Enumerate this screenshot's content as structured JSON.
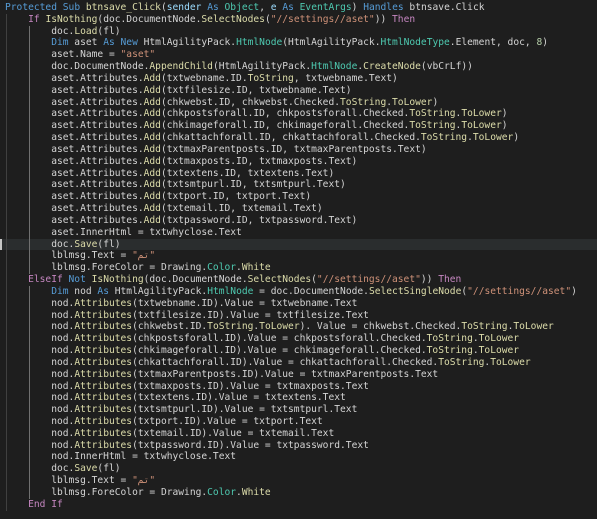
{
  "editor": {
    "colors": {
      "background": "#1e1e1e",
      "text": "#d4d4d4",
      "keyword": "#569cd6",
      "control": "#c586c0",
      "function": "#dcdcaa",
      "type": "#4ec9b0",
      "string": "#ce9178",
      "number": "#b5cea8",
      "variable": "#9cdcfe"
    },
    "lines": [
      {
        "indent": 0,
        "tokens": [
          [
            "kw",
            "Protected"
          ],
          [
            "txt",
            " "
          ],
          [
            "kw",
            "Sub"
          ],
          [
            "txt",
            " "
          ],
          [
            "fn",
            "btnsave_Click"
          ],
          [
            "txt",
            "("
          ],
          [
            "var",
            "sender"
          ],
          [
            "txt",
            " "
          ],
          [
            "kw",
            "As"
          ],
          [
            "txt",
            " "
          ],
          [
            "type",
            "Object"
          ],
          [
            "txt",
            ", "
          ],
          [
            "var",
            "e"
          ],
          [
            "txt",
            " "
          ],
          [
            "kw",
            "As"
          ],
          [
            "txt",
            " "
          ],
          [
            "type",
            "EventArgs"
          ],
          [
            "txt",
            ") "
          ],
          [
            "kw",
            "Handles"
          ],
          [
            "txt",
            " btnsave.Click"
          ]
        ]
      },
      {
        "indent": 1,
        "tokens": [
          [
            "ctl",
            "If"
          ],
          [
            "txt",
            " "
          ],
          [
            "fn",
            "IsNothing"
          ],
          [
            "txt",
            "(doc.DocumentNode."
          ],
          [
            "fn",
            "SelectNodes"
          ],
          [
            "txt",
            "("
          ],
          [
            "str",
            "\"//settings//aset\""
          ],
          [
            "txt",
            ")) "
          ],
          [
            "ctl",
            "Then"
          ]
        ]
      },
      {
        "indent": 2,
        "tokens": [
          [
            "txt",
            "doc."
          ],
          [
            "fn",
            "Load"
          ],
          [
            "txt",
            "(fl)"
          ]
        ]
      },
      {
        "indent": 2,
        "tokens": [
          [
            "kw",
            "Dim"
          ],
          [
            "txt",
            " aset "
          ],
          [
            "kw",
            "As"
          ],
          [
            "txt",
            " "
          ],
          [
            "kw",
            "New"
          ],
          [
            "txt",
            " HtmlAgilityPack."
          ],
          [
            "type",
            "HtmlNode"
          ],
          [
            "txt",
            "(HtmlAgilityPack."
          ],
          [
            "type",
            "HtmlNodeType"
          ],
          [
            "txt",
            ".Element, doc, "
          ],
          [
            "num",
            "8"
          ],
          [
            "txt",
            ")"
          ]
        ]
      },
      {
        "indent": 2,
        "tokens": [
          [
            "txt",
            "aset.Name = "
          ],
          [
            "str",
            "\"aset\""
          ]
        ]
      },
      {
        "indent": 2,
        "tokens": [
          [
            "txt",
            "doc.DocumentNode."
          ],
          [
            "fn",
            "AppendChild"
          ],
          [
            "txt",
            "(HtmlAgilityPack."
          ],
          [
            "type",
            "HtmlNode"
          ],
          [
            "txt",
            "."
          ],
          [
            "fn",
            "CreateNode"
          ],
          [
            "txt",
            "(vbCrLf))"
          ]
        ]
      },
      {
        "indent": 2,
        "tokens": [
          [
            "txt",
            "aset.Attributes."
          ],
          [
            "fn",
            "Add"
          ],
          [
            "txt",
            "(txtwebname.ID."
          ],
          [
            "fn",
            "ToString"
          ],
          [
            "txt",
            ", txtwebname.Text)"
          ]
        ]
      },
      {
        "indent": 2,
        "tokens": [
          [
            "txt",
            "aset.Attributes."
          ],
          [
            "fn",
            "Add"
          ],
          [
            "txt",
            "(txtfilesize.ID, txtwebname.Text)"
          ]
        ]
      },
      {
        "indent": 2,
        "tokens": [
          [
            "txt",
            "aset.Attributes."
          ],
          [
            "fn",
            "Add"
          ],
          [
            "txt",
            "(chkwebst.ID, chkwebst.Checked."
          ],
          [
            "fn",
            "ToString"
          ],
          [
            "txt",
            "."
          ],
          [
            "fn",
            "ToLower"
          ],
          [
            "txt",
            ")"
          ]
        ]
      },
      {
        "indent": 2,
        "tokens": [
          [
            "txt",
            "aset.Attributes."
          ],
          [
            "fn",
            "Add"
          ],
          [
            "txt",
            "(chkpostsforall.ID, chkpostsforall.Checked."
          ],
          [
            "fn",
            "ToString"
          ],
          [
            "txt",
            "."
          ],
          [
            "fn",
            "ToLower"
          ],
          [
            "txt",
            ")"
          ]
        ]
      },
      {
        "indent": 2,
        "tokens": [
          [
            "txt",
            "aset.Attributes."
          ],
          [
            "fn",
            "Add"
          ],
          [
            "txt",
            "(chkimageforall.ID, chkimageforall.Checked."
          ],
          [
            "fn",
            "ToString"
          ],
          [
            "txt",
            "."
          ],
          [
            "fn",
            "ToLower"
          ],
          [
            "txt",
            ")"
          ]
        ]
      },
      {
        "indent": 2,
        "tokens": [
          [
            "txt",
            "aset.Attributes."
          ],
          [
            "fn",
            "Add"
          ],
          [
            "txt",
            "(chkattachforall.ID, chkattachforall.Checked."
          ],
          [
            "fn",
            "ToString"
          ],
          [
            "txt",
            "."
          ],
          [
            "fn",
            "ToLower"
          ],
          [
            "txt",
            ")"
          ]
        ]
      },
      {
        "indent": 2,
        "tokens": [
          [
            "txt",
            "aset.Attributes."
          ],
          [
            "fn",
            "Add"
          ],
          [
            "txt",
            "(txtmaxParentposts.ID, txtmaxParentposts.Text)"
          ]
        ]
      },
      {
        "indent": 2,
        "tokens": [
          [
            "txt",
            "aset.Attributes."
          ],
          [
            "fn",
            "Add"
          ],
          [
            "txt",
            "(txtmaxposts.ID, txtmaxposts.Text)"
          ]
        ]
      },
      {
        "indent": 2,
        "tokens": [
          [
            "txt",
            "aset.Attributes."
          ],
          [
            "fn",
            "Add"
          ],
          [
            "txt",
            "(txtextens.ID, txtextens.Text)"
          ]
        ]
      },
      {
        "indent": 2,
        "tokens": [
          [
            "txt",
            "aset.Attributes."
          ],
          [
            "fn",
            "Add"
          ],
          [
            "txt",
            "(txtsmtpurl.ID, txtsmtpurl.Text)"
          ]
        ]
      },
      {
        "indent": 2,
        "tokens": [
          [
            "txt",
            "aset.Attributes."
          ],
          [
            "fn",
            "Add"
          ],
          [
            "txt",
            "(txtport.ID, txtport.Text)"
          ]
        ]
      },
      {
        "indent": 2,
        "tokens": [
          [
            "txt",
            "aset.Attributes."
          ],
          [
            "fn",
            "Add"
          ],
          [
            "txt",
            "(txtemail.ID, txtemail.Text)"
          ]
        ]
      },
      {
        "indent": 2,
        "tokens": [
          [
            "txt",
            "aset.Attributes."
          ],
          [
            "fn",
            "Add"
          ],
          [
            "txt",
            "(txtpassword.ID, txtpassword.Text)"
          ]
        ]
      },
      {
        "indent": 2,
        "tokens": [
          [
            "txt",
            "aset.InnerHtml = txtwhyclose.Text"
          ]
        ]
      },
      {
        "indent": 2,
        "highlight": true,
        "tokens": [
          [
            "txt",
            "doc."
          ],
          [
            "fn",
            "Save"
          ],
          [
            "txt",
            "(fl)"
          ]
        ]
      },
      {
        "indent": 2,
        "tokens": [
          [
            "txt",
            "lblmsg.Text = "
          ],
          [
            "str",
            "\"تم\""
          ]
        ]
      },
      {
        "indent": 2,
        "tokens": [
          [
            "txt",
            "lblmsg.ForeColor = Drawing."
          ],
          [
            "type",
            "Color"
          ],
          [
            "txt",
            "."
          ],
          [
            "fn",
            "White"
          ]
        ]
      },
      {
        "indent": 1,
        "tokens": [
          [
            "ctl",
            "ElseIf"
          ],
          [
            "txt",
            " "
          ],
          [
            "kw",
            "Not"
          ],
          [
            "txt",
            " "
          ],
          [
            "fn",
            "IsNothing"
          ],
          [
            "txt",
            "(doc.DocumentNode."
          ],
          [
            "fn",
            "SelectNodes"
          ],
          [
            "txt",
            "("
          ],
          [
            "str",
            "\"//settings//aset\""
          ],
          [
            "txt",
            ")) "
          ],
          [
            "ctl",
            "Then"
          ]
        ]
      },
      {
        "indent": 2,
        "tokens": [
          [
            "kw",
            "Dim"
          ],
          [
            "txt",
            " nod "
          ],
          [
            "kw",
            "As"
          ],
          [
            "txt",
            " HtmlAgilityPack."
          ],
          [
            "type",
            "HtmlNode"
          ],
          [
            "txt",
            " = doc.DocumentNode."
          ],
          [
            "fn",
            "SelectSingleNode"
          ],
          [
            "txt",
            "("
          ],
          [
            "str",
            "\"//settings//aset\""
          ],
          [
            "txt",
            ")"
          ]
        ]
      },
      {
        "indent": 2,
        "tokens": [
          [
            "txt",
            "nod."
          ],
          [
            "fn",
            "Attributes"
          ],
          [
            "txt",
            "(txtwebname.ID).Value = txtwebname.Text"
          ]
        ]
      },
      {
        "indent": 2,
        "tokens": [
          [
            "txt",
            "nod."
          ],
          [
            "fn",
            "Attributes"
          ],
          [
            "txt",
            "(txtfilesize.ID).Value = txtfilesize.Text"
          ]
        ]
      },
      {
        "indent": 2,
        "tokens": [
          [
            "txt",
            "nod."
          ],
          [
            "fn",
            "Attributes"
          ],
          [
            "txt",
            "(chkwebst.ID."
          ],
          [
            "fn",
            "ToString"
          ],
          [
            "txt",
            "."
          ],
          [
            "fn",
            "ToLower"
          ],
          [
            "txt",
            "). Value = chkwebst.Checked."
          ],
          [
            "fn",
            "ToString"
          ],
          [
            "txt",
            "."
          ],
          [
            "fn",
            "ToLower"
          ]
        ]
      },
      {
        "indent": 2,
        "tokens": [
          [
            "txt",
            "nod."
          ],
          [
            "fn",
            "Attributes"
          ],
          [
            "txt",
            "(chkpostsforall.ID).Value = chkpostsforall.Checked."
          ],
          [
            "fn",
            "ToString"
          ],
          [
            "txt",
            "."
          ],
          [
            "fn",
            "ToLower"
          ]
        ]
      },
      {
        "indent": 2,
        "tokens": [
          [
            "txt",
            "nod."
          ],
          [
            "fn",
            "Attributes"
          ],
          [
            "txt",
            "(chkimageforall.ID).Value = chkimageforall.Checked."
          ],
          [
            "fn",
            "ToString"
          ],
          [
            "txt",
            "."
          ],
          [
            "fn",
            "ToLower"
          ]
        ]
      },
      {
        "indent": 2,
        "tokens": [
          [
            "txt",
            "nod."
          ],
          [
            "fn",
            "Attributes"
          ],
          [
            "txt",
            "(chkattachforall.ID).Value = chkattachforall.Checked."
          ],
          [
            "fn",
            "ToString"
          ],
          [
            "txt",
            "."
          ],
          [
            "fn",
            "ToLower"
          ]
        ]
      },
      {
        "indent": 2,
        "tokens": [
          [
            "txt",
            "nod."
          ],
          [
            "fn",
            "Attributes"
          ],
          [
            "txt",
            "(txtmaxParentposts.ID).Value = txtmaxParentposts.Text"
          ]
        ]
      },
      {
        "indent": 2,
        "tokens": [
          [
            "txt",
            "nod."
          ],
          [
            "fn",
            "Attributes"
          ],
          [
            "txt",
            "(txtmaxposts.ID).Value = txtmaxposts.Text"
          ]
        ]
      },
      {
        "indent": 2,
        "tokens": [
          [
            "txt",
            "nod."
          ],
          [
            "fn",
            "Attributes"
          ],
          [
            "txt",
            "(txtextens.ID).Value = txtextens.Text"
          ]
        ]
      },
      {
        "indent": 2,
        "tokens": [
          [
            "txt",
            "nod."
          ],
          [
            "fn",
            "Attributes"
          ],
          [
            "txt",
            "(txtsmtpurl.ID).Value = txtsmtpurl.Text"
          ]
        ]
      },
      {
        "indent": 2,
        "tokens": [
          [
            "txt",
            "nod."
          ],
          [
            "fn",
            "Attributes"
          ],
          [
            "txt",
            "(txtport.ID).Value = txtport.Text"
          ]
        ]
      },
      {
        "indent": 2,
        "tokens": [
          [
            "txt",
            "nod."
          ],
          [
            "fn",
            "Attributes"
          ],
          [
            "txt",
            "(txtemail.ID).Value = txtemail.Text"
          ]
        ]
      },
      {
        "indent": 2,
        "tokens": [
          [
            "txt",
            "nod."
          ],
          [
            "fn",
            "Attributes"
          ],
          [
            "txt",
            "(txtpassword.ID).Value = txtpassword.Text"
          ]
        ]
      },
      {
        "indent": 2,
        "tokens": [
          [
            "txt",
            "nod.InnerHtml = txtwhyclose.Text"
          ]
        ]
      },
      {
        "indent": 2,
        "tokens": [
          [
            "txt",
            "doc."
          ],
          [
            "fn",
            "Save"
          ],
          [
            "txt",
            "(fl)"
          ]
        ]
      },
      {
        "indent": 2,
        "tokens": [
          [
            "txt",
            "lblmsg.Text = "
          ],
          [
            "str",
            "\"تم\""
          ]
        ]
      },
      {
        "indent": 2,
        "tokens": [
          [
            "txt",
            "lblmsg.ForeColor = Drawing."
          ],
          [
            "type",
            "Color"
          ],
          [
            "txt",
            "."
          ],
          [
            "fn",
            "White"
          ]
        ]
      },
      {
        "indent": 1,
        "tokens": [
          [
            "ctl",
            "End"
          ],
          [
            "txt",
            " "
          ],
          [
            "ctl",
            "If"
          ]
        ]
      }
    ]
  }
}
